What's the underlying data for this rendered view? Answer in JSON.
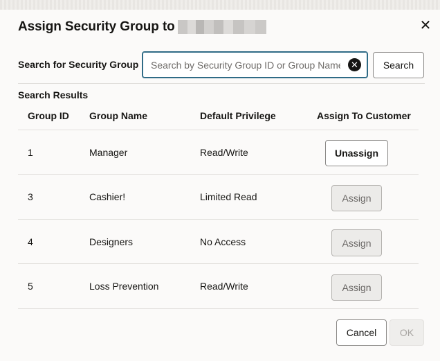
{
  "dialog": {
    "title": "Assign Security Group to",
    "close_label": "✕"
  },
  "search": {
    "label": "Search for Security Group",
    "placeholder": "Search by Security Group ID or Group Name",
    "value": "",
    "clear_label": "✕",
    "button_label": "Search"
  },
  "results": {
    "label": "Search Results",
    "columns": [
      "Group ID",
      "Group Name",
      "Default Privilege",
      "Assign To Customer"
    ],
    "rows": [
      {
        "id": "1",
        "name": "Manager",
        "privilege": "Read/Write",
        "action": "Unassign"
      },
      {
        "id": "3",
        "name": "Cashier!",
        "privilege": "Limited Read",
        "action": "Assign"
      },
      {
        "id": "4",
        "name": "Designers",
        "privilege": "No Access",
        "action": "Assign"
      },
      {
        "id": "5",
        "name": "Loss Prevention",
        "privilege": "Read/Write",
        "action": "Assign"
      }
    ]
  },
  "footer": {
    "cancel_label": "Cancel",
    "ok_label": "OK"
  }
}
